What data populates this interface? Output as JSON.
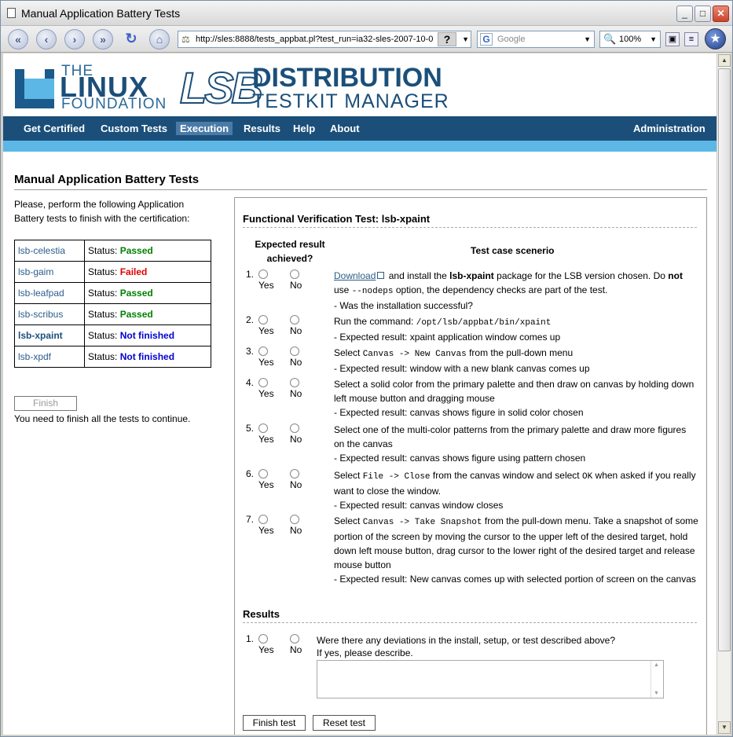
{
  "window": {
    "title": "Manual Application Battery Tests",
    "url": "http://sles:8888/tests_appbat.pl?test_run=ia32-sles-2007-10-0",
    "search_placeholder": "Google",
    "zoom": "100%"
  },
  "logo": {
    "the": "THE",
    "linux": "LINUX",
    "foundation": "FOUNDATION",
    "lsb": "LSB",
    "distribution": "DISTRIBUTION",
    "testkit_manager": "TESTKIT MANAGER"
  },
  "nav": {
    "items": [
      "Get Certified",
      "Custom Tests",
      "Execution",
      "Results",
      "Help",
      "About"
    ],
    "active": "Execution",
    "admin": "Administration"
  },
  "page": {
    "title": "Manual Application Battery Tests",
    "intro": "Please, perform the following Application Battery tests to finish with the certification:",
    "status_label": "Status:",
    "tests": [
      {
        "name": "lsb-celestia",
        "status": "Passed"
      },
      {
        "name": "lsb-gaim",
        "status": "Failed"
      },
      {
        "name": "lsb-leafpad",
        "status": "Passed"
      },
      {
        "name": "lsb-scribus",
        "status": "Passed"
      },
      {
        "name": "lsb-xpaint",
        "status": "Not finished"
      },
      {
        "name": "lsb-xpdf",
        "status": "Not finished"
      }
    ],
    "finish_label": "Finish",
    "finish_note": "You need to finish all the tests to continue."
  },
  "panel": {
    "heading": "Functional Verification Test: lsb-xpaint",
    "col_expected": "Expected result achieved?",
    "col_scenario": "Test case scenerio",
    "yes": "Yes",
    "no": "No",
    "steps": [
      {
        "n": "1.",
        "parts": [
          "Download",
          "and install the",
          "lsb-xpaint",
          "package for the LSB version chosen. Do",
          "not",
          "use",
          "--nodeps",
          "option, the dependency checks are part of the test.",
          "- Was the installation successful?"
        ]
      },
      {
        "n": "2.",
        "parts": [
          "Run the command:",
          "/opt/lsb/appbat/bin/xpaint",
          "- Expected result: xpaint application window comes up"
        ]
      },
      {
        "n": "3.",
        "parts": [
          "Select",
          "Canvas -> New Canvas",
          "from the pull-down menu",
          "- Expected result: window with a new blank canvas comes up"
        ]
      },
      {
        "n": "4.",
        "parts": [
          "Select a solid color from the primary palette and then draw on canvas by holding down left mouse button and dragging mouse",
          "- Expected result: canvas shows figure in solid color chosen"
        ]
      },
      {
        "n": "5.",
        "parts": [
          "Select one of the multi-color patterns from the primary palette and draw more figures on the canvas",
          "- Expected result: canvas shows figure using pattern chosen"
        ]
      },
      {
        "n": "6.",
        "parts": [
          "Select",
          "File -> Close",
          "from the canvas window and select",
          "OK",
          "when asked if you really want to close the window.",
          "- Expected result: canvas window closes"
        ]
      },
      {
        "n": "7.",
        "parts": [
          "Select",
          "Canvas -> Take Snapshot",
          "from the pull-down menu. Take a snapshot of some portion of the screen by moving the cursor to the upper left of the desired target, hold down left mouse button, drag cursor to the lower right of the desired target and release mouse button",
          "- Expected result: New canvas comes up with selected portion of screen on the canvas"
        ]
      }
    ],
    "results_heading": "Results",
    "results_n": "1.",
    "results_question": "Were there any deviations in the install, setup, or test described above?",
    "results_ifyes": "If yes, please describe.",
    "finish_test": "Finish test",
    "reset_test": "Reset test"
  }
}
